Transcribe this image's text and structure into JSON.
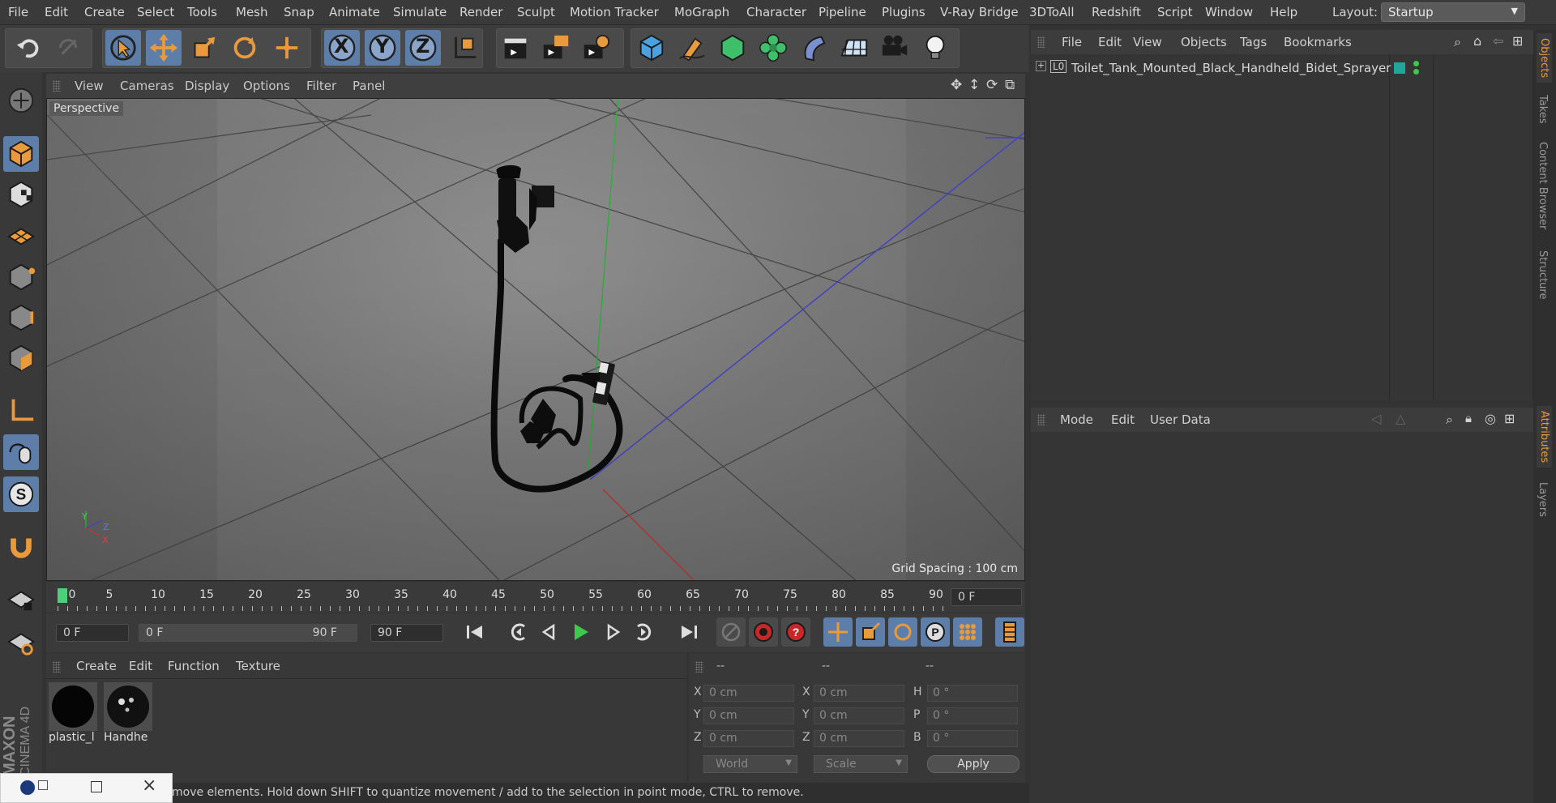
{
  "menubar": {
    "items": [
      "File",
      "Edit",
      "Create",
      "Select",
      "Tools",
      "Mesh",
      "Snap",
      "Animate",
      "Simulate",
      "Render",
      "Sculpt",
      "Motion Tracker",
      "MoGraph",
      "Character",
      "Pipeline",
      "Plugins",
      "V-Ray Bridge",
      "3DToAll",
      "Redshift",
      "Script",
      "Window",
      "Help"
    ],
    "layout_label": "Layout:",
    "layout_value": "Startup"
  },
  "toolbar": {
    "axis_x": "X",
    "axis_y": "Y",
    "axis_z": "Z"
  },
  "viewport": {
    "menu": [
      "View",
      "Cameras",
      "Display",
      "Options",
      "Filter",
      "Panel"
    ],
    "camera_label": "Perspective",
    "grid_spacing": "Grid Spacing : 100 cm",
    "axis_y": "Y",
    "axis_z": "Z",
    "axis_x": "X"
  },
  "timeline": {
    "ticks": [
      "0",
      "5",
      "10",
      "15",
      "20",
      "25",
      "30",
      "35",
      "40",
      "45",
      "50",
      "55",
      "60",
      "65",
      "70",
      "75",
      "80",
      "85",
      "90"
    ],
    "current_frame": "0 F",
    "start_frame": "0 F",
    "range_start": "0 F",
    "range_end": "90 F",
    "end_frame": "90 F"
  },
  "materials": {
    "menu": [
      "Create",
      "Edit",
      "Function",
      "Texture"
    ],
    "items": [
      {
        "label": "plastic_l"
      },
      {
        "label": "Handhe"
      }
    ]
  },
  "coordinates": {
    "headers": [
      "--",
      "--",
      "--"
    ],
    "rows": [
      {
        "l1": "X",
        "v1": "0 cm",
        "l2": "X",
        "v2": "0 cm",
        "l3": "H",
        "v3": "0 °"
      },
      {
        "l1": "Y",
        "v1": "0 cm",
        "l2": "Y",
        "v2": "0 cm",
        "l3": "P",
        "v3": "0 °"
      },
      {
        "l1": "Z",
        "v1": "0 cm",
        "l2": "Z",
        "v2": "0 cm",
        "l3": "B",
        "v3": "0 °"
      }
    ],
    "space": "World",
    "mode": "Scale",
    "apply_label": "Apply"
  },
  "statusbar": {
    "text": "move elements. Hold down SHIFT to quantize movement / add to the selection in point mode, CTRL to remove."
  },
  "object_manager": {
    "menu": [
      "File",
      "Edit",
      "View",
      "Objects",
      "Tags",
      "Bookmarks"
    ],
    "object_name": "Toilet_Tank_Mounted_Black_Handheld_Bidet_Sprayer",
    "layer_marker": "L0"
  },
  "attributes": {
    "menu": [
      "Mode",
      "Edit",
      "User Data"
    ]
  },
  "side_tabs": [
    "Objects",
    "Takes",
    "Content Browser",
    "Structure",
    "Attributes",
    "Layers"
  ],
  "brand": {
    "maxon": "MAXON",
    "product": "CINEMA 4D"
  },
  "colors": {
    "accent": "#e89a3c",
    "highlight": "#5d7ea9",
    "timeline_marker": "#4cd07a"
  }
}
